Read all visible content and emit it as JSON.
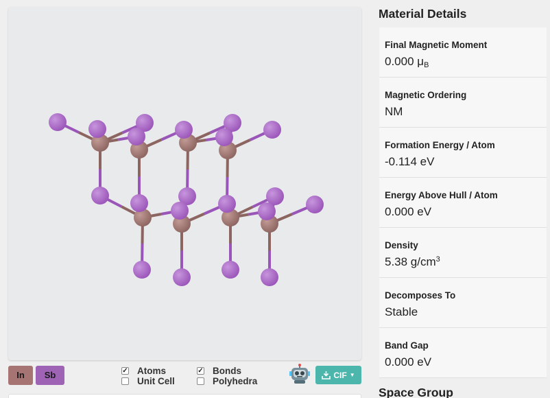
{
  "viewer": {
    "elements": [
      {
        "symbol": "In",
        "color": "#a67573"
      },
      {
        "symbol": "Sb",
        "color": "#9e63b5"
      }
    ],
    "toggles": [
      {
        "label": "Atoms",
        "checked": true
      },
      {
        "label": "Unit Cell",
        "checked": false
      },
      {
        "label": "Bonds",
        "checked": true
      },
      {
        "label": "Polyhedra",
        "checked": false
      }
    ],
    "export_label": "CIF",
    "colors": {
      "in_atom": "#8c6560",
      "sb_atom": "#9a55b8",
      "bond_in": "#8c6560",
      "bond_sb": "#9a55b8"
    }
  },
  "details": {
    "title": "Material Details",
    "rows": [
      {
        "label": "Final Magnetic Moment",
        "value": "0.000 μ",
        "sub": "B",
        "sup": ""
      },
      {
        "label": "Magnetic Ordering",
        "value": "NM",
        "sub": "",
        "sup": ""
      },
      {
        "label": "Formation Energy / Atom",
        "value": "-0.114 eV",
        "sub": "",
        "sup": ""
      },
      {
        "label": "Energy Above Hull / Atom",
        "value": "0.000 eV",
        "sub": "",
        "sup": ""
      },
      {
        "label": "Density",
        "value": "5.38 g/cm",
        "sub": "",
        "sup": "3"
      },
      {
        "label": "Decomposes To",
        "value": "Stable",
        "sub": "",
        "sup": ""
      },
      {
        "label": "Band Gap",
        "value": "0.000 eV",
        "sub": "",
        "sup": ""
      }
    ],
    "next_section": "Space Group"
  }
}
